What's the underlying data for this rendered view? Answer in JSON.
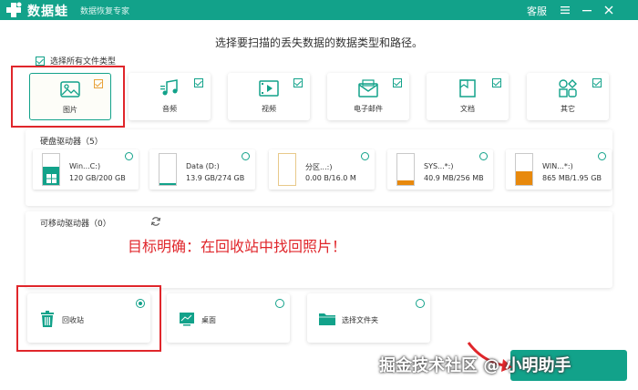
{
  "titlebar": {
    "app_name": "数据蛙",
    "app_subtitle": "数据恢复专家",
    "support": "客服",
    "menu_icon": "hamburger-icon",
    "minimize_icon": "minimize-icon",
    "close_icon": "close-icon"
  },
  "heading": "选择要扫描的丢失数据的数据类型和路径。",
  "select_all": {
    "label": "选择所有文件类型",
    "checked": true
  },
  "file_types": [
    {
      "label": "图片",
      "icon": "image-icon",
      "checked": true,
      "selected": true
    },
    {
      "label": "音频",
      "icon": "audio-icon",
      "checked": true
    },
    {
      "label": "视频",
      "icon": "video-icon",
      "checked": true
    },
    {
      "label": "电子邮件",
      "icon": "email-icon",
      "checked": true
    },
    {
      "label": "文档",
      "icon": "document-icon",
      "checked": true
    },
    {
      "label": "其它",
      "icon": "other-icon",
      "checked": true
    }
  ],
  "hard_drives": {
    "title": "硬盘驱动器（5）",
    "drives": [
      {
        "name": "Win...C:)",
        "size": "120 GB/200 GB",
        "fill": 0.6,
        "color": "#12a28a",
        "os": true
      },
      {
        "name": "Data (D:)",
        "size": "13.9 GB/274 GB",
        "fill": 0.05,
        "color": "#12a28a"
      },
      {
        "name": "分区...:)",
        "size": "0.00  B/16.0 M",
        "fill": 0.0,
        "color": "#e8a23a"
      },
      {
        "name": "SYS...*:)",
        "size": "40.9 MB/256 MB",
        "fill": 0.16,
        "color": "#e8890c"
      },
      {
        "name": "WIN...*:)",
        "size": "865 MB/1.95 GB",
        "fill": 0.44,
        "color": "#e8890c"
      }
    ]
  },
  "removable": {
    "title": "可移动驱动器（0）"
  },
  "annotation": "目标明确：在回收站中找回照片！",
  "locations": [
    {
      "label": "回收站",
      "icon": "trash-icon",
      "selected": true
    },
    {
      "label": "桌面",
      "icon": "desktop-icon",
      "selected": false
    },
    {
      "label": "选择文件夹",
      "icon": "folder-icon",
      "selected": false
    }
  ],
  "watermark": "掘金技术社区 @ 小明助手",
  "colors": {
    "brand": "#12a28a",
    "annotation_red": "#e0262b",
    "accent_orange": "#e8890c"
  }
}
